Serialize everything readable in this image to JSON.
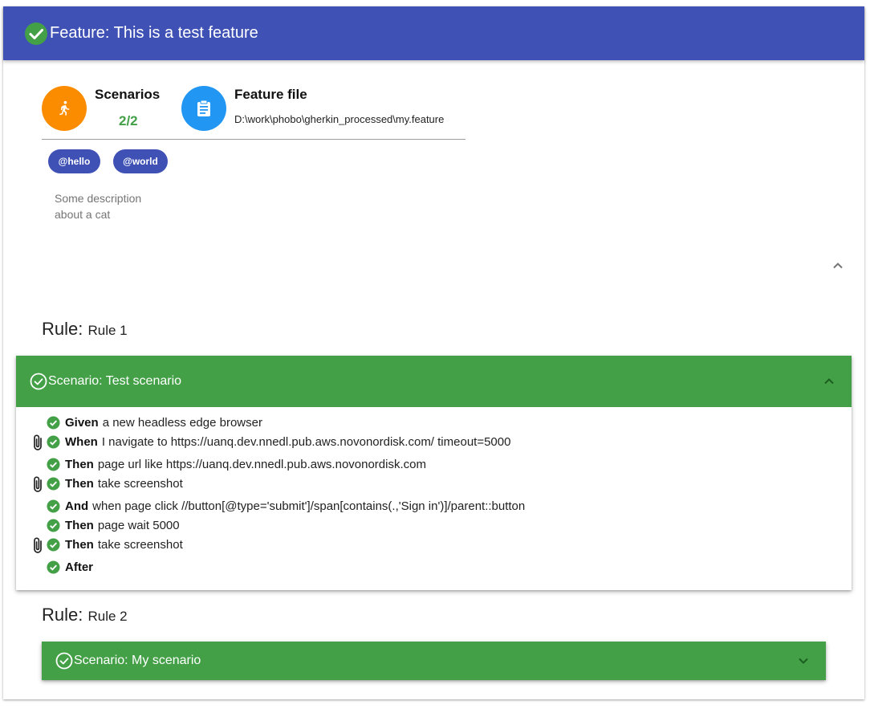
{
  "feature": {
    "title": "Feature: This is a test feature"
  },
  "stats": {
    "scenarios_label": "Scenarios",
    "scenarios_value": "2/2",
    "file_label": "Feature file",
    "file_path": "D:\\work\\phobo\\gherkin_processed\\my.feature"
  },
  "tags": [
    "@hello",
    "@world"
  ],
  "description": [
    "Some description",
    "about a cat"
  ],
  "rules": [
    {
      "prefix": "Rule:",
      "name": "Rule 1",
      "scenario": {
        "title": "Scenario: Test scenario",
        "expanded": true,
        "steps": [
          {
            "keyword": "Given",
            "text": "a new headless edge browser",
            "attachment": false
          },
          {
            "keyword": "When",
            "text": "I navigate to https://uanq.dev.nnedl.pub.aws.novonordisk.com/ timeout=5000",
            "attachment": true
          },
          {
            "keyword": "Then",
            "text": "page url like https://uanq.dev.nnedl.pub.aws.novonordisk.com",
            "attachment": false
          },
          {
            "keyword": "Then",
            "text": "take screenshot",
            "attachment": true
          },
          {
            "keyword": "And",
            "text": "when page click //button[@type='submit']/span[contains(.,'Sign in')]/parent::button",
            "attachment": false
          },
          {
            "keyword": "Then",
            "text": "page wait 5000",
            "attachment": false
          },
          {
            "keyword": "Then",
            "text": "take screenshot",
            "attachment": true
          },
          {
            "keyword": "After",
            "text": "",
            "attachment": false
          }
        ]
      }
    },
    {
      "prefix": "Rule:",
      "name": "Rule 2",
      "scenario": {
        "title": "Scenario: My scenario",
        "expanded": false
      }
    }
  ],
  "colors": {
    "header": "#3f51b5",
    "passed": "#43a047",
    "scenarios_icon": "#fb8c00",
    "file_icon": "#2196f3",
    "tag": "#3f51b5"
  },
  "icons": {
    "status": "check-circle-icon",
    "scenarios": "run-icon",
    "file": "clipboard-icon",
    "collapse": "chevron-up-icon",
    "expand": "chevron-down-icon",
    "attachment": "paperclip-icon"
  }
}
